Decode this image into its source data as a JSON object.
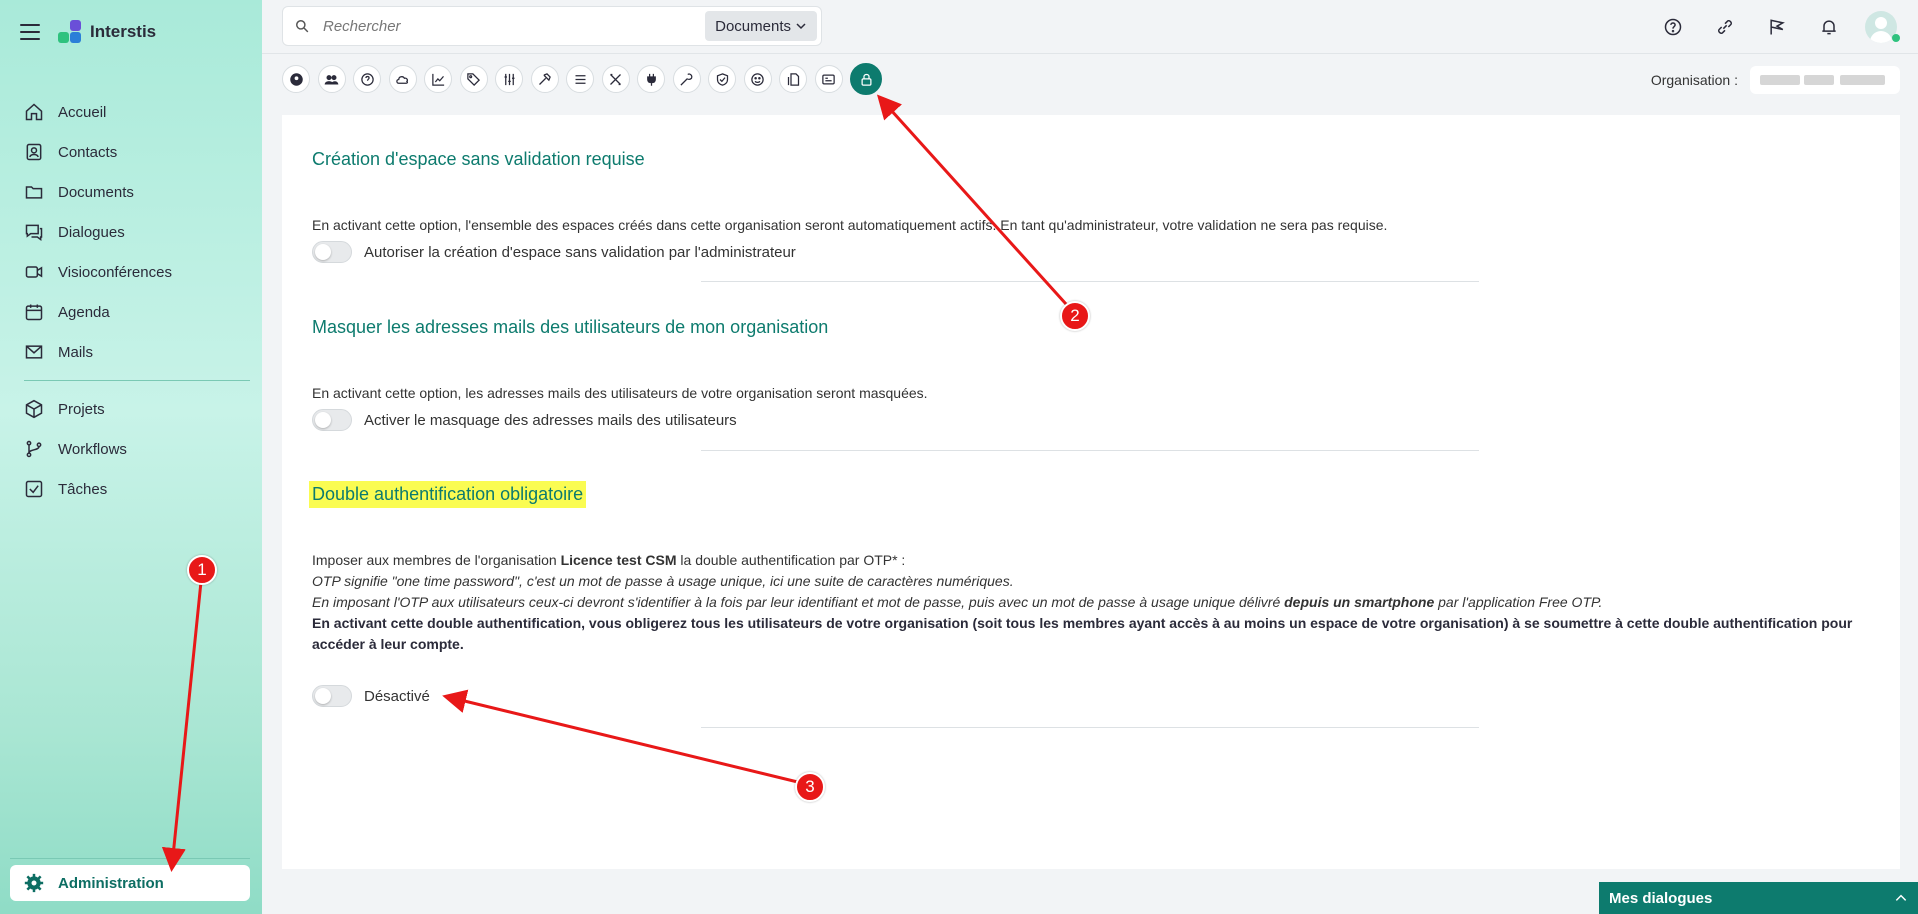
{
  "app": {
    "name": "Interstis"
  },
  "search": {
    "placeholder": "Rechercher",
    "scope": "Documents"
  },
  "sidebar": {
    "items": [
      {
        "label": "Accueil",
        "icon": "home-icon"
      },
      {
        "label": "Contacts",
        "icon": "contacts-icon"
      },
      {
        "label": "Documents",
        "icon": "folder-icon"
      },
      {
        "label": "Dialogues",
        "icon": "chat-icon"
      },
      {
        "label": "Visioconférences",
        "icon": "video-icon"
      },
      {
        "label": "Agenda",
        "icon": "calendar-icon"
      },
      {
        "label": "Mails",
        "icon": "mail-icon"
      },
      {
        "label": "Projets",
        "icon": "cube-icon"
      },
      {
        "label": "Workflows",
        "icon": "branch-icon"
      },
      {
        "label": "Tâches",
        "icon": "checkbox-icon"
      }
    ],
    "admin_label": "Administration"
  },
  "org": {
    "label": "Organisation :"
  },
  "sections": {
    "s1": {
      "title": "Création d'espace sans validation requise",
      "desc": "En activant cette option, l'ensemble des espaces créés dans cette organisation seront automatiquement actifs. En tant qu'administrateur, votre validation ne sera pas requise.",
      "toggle_label": "Autoriser la création d'espace sans validation par l'administrateur"
    },
    "s2": {
      "title": "Masquer les adresses mails des utilisateurs de mon organisation",
      "desc": "En activant cette option, les adresses mails des utilisateurs de votre organisation seront masquées.",
      "toggle_label": "Activer le masquage des adresses mails des utilisateurs"
    },
    "s3": {
      "title": "Double authentification obligatoire",
      "line1_a": "Imposer aux membres de l'organisation ",
      "line1_b": "Licence test CSM",
      "line1_c": " la double authentification par OTP* :",
      "line2": "OTP signifie \"one time password\", c'est un mot de passe à usage unique, ici une suite de caractères numériques.",
      "line3_a": "En imposant l'OTP aux utilisateurs ceux-ci devront s'identifier à la fois par leur identifiant et mot de passe, puis avec un mot de passe à usage unique délivré ",
      "line3_b": "depuis un smartphone",
      "line3_c": " par l'application Free OTP.",
      "line4": "En activant cette double authentification, vous obligerez tous les utilisateurs de votre organisation (soit tous les membres ayant accès à au moins un espace de votre organisation) à se soumettre à cette double authentification pour accéder à leur compte.",
      "toggle_label": "Désactivé"
    }
  },
  "dialogs_bar": {
    "label": "Mes dialogues"
  },
  "annotations": {
    "b1": "1",
    "b2": "2",
    "b3": "3"
  },
  "colors": {
    "accent": "#0d7b6e",
    "highlight": "#fafc52",
    "annotation": "#e81818"
  }
}
